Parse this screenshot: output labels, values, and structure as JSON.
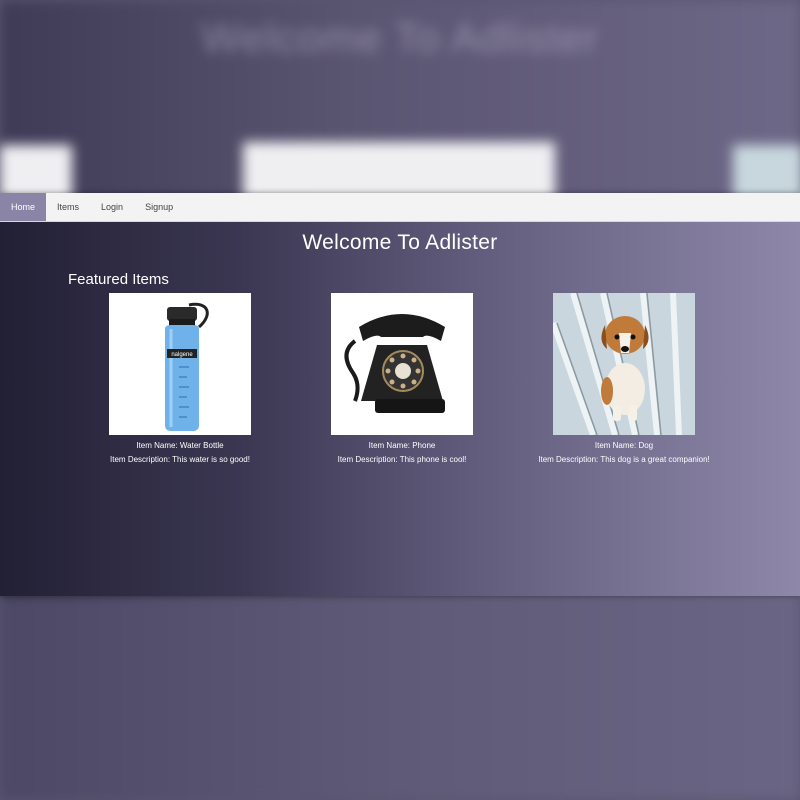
{
  "backdrop": {
    "title": "Welcome To Adlister"
  },
  "nav": {
    "items": [
      {
        "label": "Home",
        "active": true
      },
      {
        "label": "Items",
        "active": false
      },
      {
        "label": "Login",
        "active": false
      },
      {
        "label": "Signup",
        "active": false
      }
    ]
  },
  "page": {
    "title": "Welcome To Adlister",
    "section_title": "Featured Items"
  },
  "items": [
    {
      "name": "Item Name: Water Bottle",
      "description": "Item Description: This water is so good!",
      "image": "water-bottle-image"
    },
    {
      "name": "Item Name: Phone",
      "description": "Item Description: This phone is cool!",
      "image": "rotary-phone-image"
    },
    {
      "name": "Item Name: Dog",
      "description": "Item Description: This dog is a great companion!",
      "image": "puppy-image"
    }
  ],
  "colors": {
    "nav_active": "#8a84a6",
    "navbar_bg": "#f3f3f4",
    "text": "#ffffff"
  }
}
